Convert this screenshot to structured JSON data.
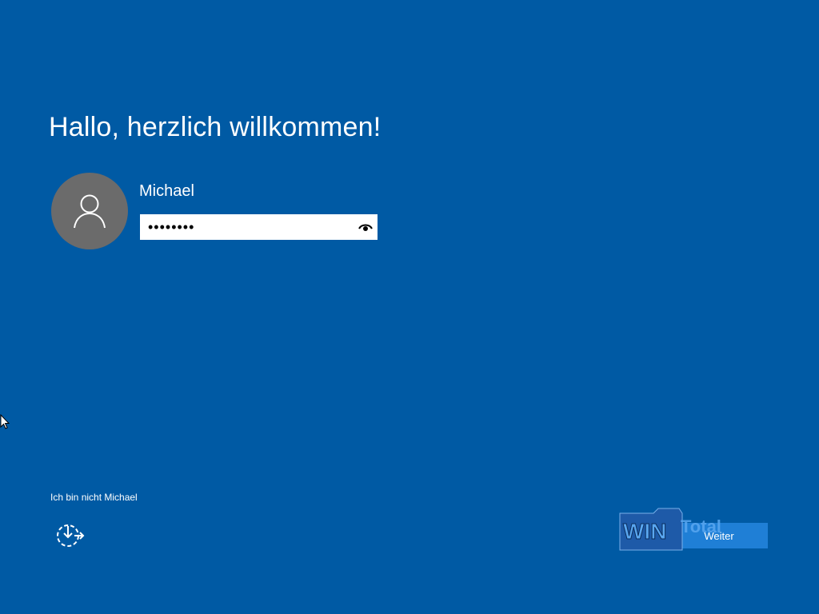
{
  "greeting": {
    "title": "Hallo, herzlich willkommen!"
  },
  "user": {
    "name": "Michael",
    "avatar_icon": "user-icon"
  },
  "password": {
    "value": "••••••••",
    "reveal_icon": "eye-icon"
  },
  "links": {
    "not_user": "Ich bin nicht Michael"
  },
  "buttons": {
    "next_label": "Weiter",
    "accessibility_icon": "ease-of-access-icon"
  },
  "watermark": {
    "text": "WinTotal"
  },
  "colors": {
    "background": "#005aa4",
    "avatar": "#6b6b6b",
    "next_button": "#1f7fd6",
    "text": "#ffffff"
  }
}
